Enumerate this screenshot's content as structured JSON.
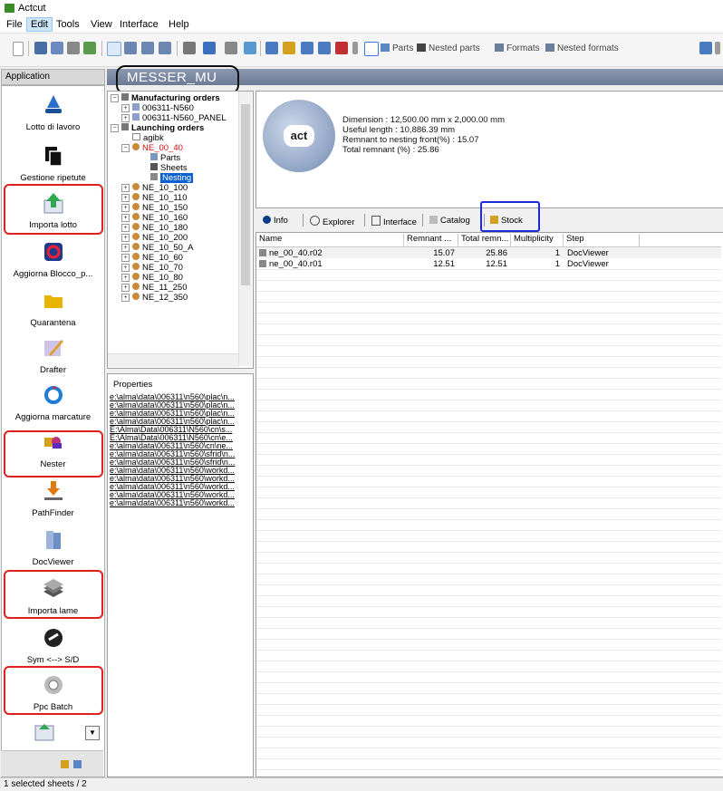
{
  "window": {
    "title": "Actcut"
  },
  "menu": [
    "File",
    "Edit",
    "Tools",
    "View",
    "Interface",
    "Help"
  ],
  "toolbar": {
    "parts": "Parts",
    "nested_parts": "Nested parts",
    "formats": "Formats",
    "nested_formats": "Nested formats"
  },
  "app_panel": {
    "header": "Application",
    "items": [
      {
        "label": "Lotto di lavoro",
        "icon": "ship-icon",
        "color": "#2a6fc9"
      },
      {
        "label": "Gestione ripetute",
        "icon": "copy-icon",
        "color": "#111111"
      },
      {
        "label": "Importa lotto",
        "icon": "import-arrow-icon",
        "color": "#2fa84f"
      },
      {
        "label": "Aggiorna Blocco_p...",
        "icon": "refresh-icon",
        "color": "#1e3a8a"
      },
      {
        "label": "Quarantena",
        "icon": "folder-icon",
        "color": "#e8b400"
      },
      {
        "label": "Drafter",
        "icon": "pencil-icon",
        "color": "#8a6bbf"
      },
      {
        "label": "Aggiorna marcature",
        "icon": "cycle-icon",
        "color": "#1e7bd6"
      },
      {
        "label": "Nester",
        "icon": "shapes-icon",
        "color": "#d9a11a"
      },
      {
        "label": "PathFinder",
        "icon": "path-icon",
        "color": "#e07a10"
      },
      {
        "label": "DocViewer",
        "icon": "book-icon",
        "color": "#6c8fc7"
      },
      {
        "label": "Importa lame",
        "icon": "stack-icon",
        "color": "#777777"
      },
      {
        "label": "Sym <--> S/D",
        "icon": "swap-icon",
        "color": "#222222"
      },
      {
        "label": "Ppc Batch",
        "icon": "gear-icon",
        "color": "#999999"
      }
    ]
  },
  "header": {
    "title": "MESSER_MU"
  },
  "tree": {
    "rows": [
      {
        "text": "Manufacturing orders",
        "bold": true
      },
      {
        "text": "006311-N560"
      },
      {
        "text": "006311-N560_PANEL"
      },
      {
        "text": "Launching orders",
        "bold": true
      },
      {
        "text": "agibk"
      },
      {
        "text": "NE_00_40",
        "red": true
      },
      {
        "text": "Parts"
      },
      {
        "text": "Sheets"
      },
      {
        "text": "Nesting",
        "selected": true
      },
      {
        "text": "NE_10_100"
      },
      {
        "text": "NE_10_110"
      },
      {
        "text": "NE_10_150"
      },
      {
        "text": "NE_10_160"
      },
      {
        "text": "NE_10_180"
      },
      {
        "text": "NE_10_200"
      },
      {
        "text": "NE_10_50_A"
      },
      {
        "text": "NE_10_60"
      },
      {
        "text": "NE_10_70"
      },
      {
        "text": "NE_10_80"
      },
      {
        "text": "NE_11_250"
      },
      {
        "text": "NE_12_350"
      }
    ]
  },
  "properties": {
    "header": "Properties",
    "lines": [
      "e:\\alma\\data\\006311\\n560\\plac\\n...",
      "e:\\alma\\data\\006311\\n560\\plac\\n...",
      "e:\\alma\\data\\006311\\n560\\plac\\n...",
      "e:\\alma\\data\\006311\\n560\\plac\\n...",
      "E:\\Alma\\Data\\006311\\N560\\cn\\s...",
      "E:\\Alma\\Data\\006311\\N560\\cn\\e...",
      "e:\\alma\\data\\006311\\n560\\cn\\ne...",
      "e:\\alma\\data\\006311\\n560\\sfrid\\n...",
      "e:\\alma\\data\\006311\\n560\\sfrid\\n...",
      "e:\\alma\\data\\006311\\n560\\workd...",
      "e:\\alma\\data\\006311\\n560\\workd...",
      "e:\\alma\\data\\006311\\n560\\workd...",
      "e:\\alma\\data\\006311\\n560\\workd...",
      "e:\\alma\\data\\006311\\n560\\workd..."
    ]
  },
  "info": {
    "logo_text": "act",
    "lines": [
      "Dimension : 12,500.00 mm x 2,000.00 mm",
      "Useful length : 10,886.39 mm",
      "Remnant to nesting front(%) : 15.07",
      "Total remnant (%) : 25.86"
    ]
  },
  "tabs": [
    "Info",
    "Explorer",
    "Interface",
    "Catalog",
    "Stock"
  ],
  "grid": {
    "columns": [
      "Name",
      "Remnant ...",
      "Total remn...",
      "Multiplicity",
      "Step"
    ],
    "rows": [
      [
        "ne_00_40.r02",
        "15.07",
        "25.86",
        "1",
        "DocViewer"
      ],
      [
        "ne_00_40.r01",
        "12.51",
        "12.51",
        "1",
        "DocViewer"
      ]
    ]
  },
  "status": "1 selected sheets / 2"
}
